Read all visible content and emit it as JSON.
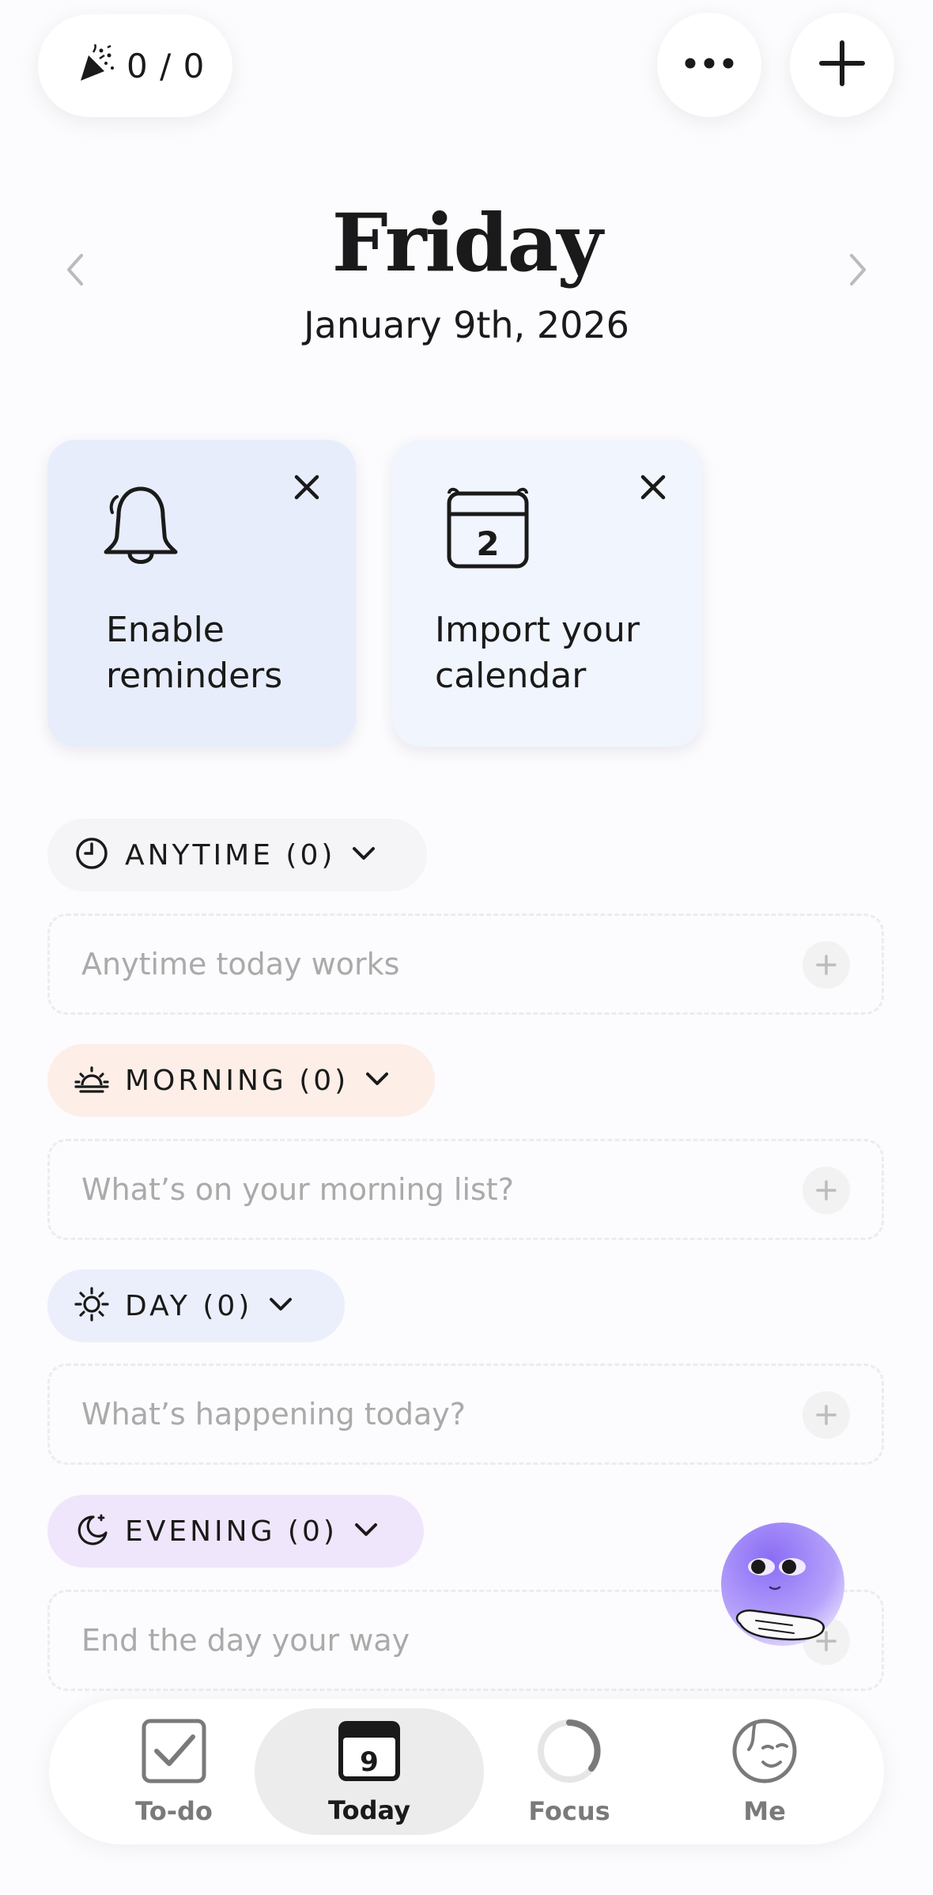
{
  "header": {
    "streak_count": "0 / 0",
    "more_icon": "ellipsis-icon",
    "add_icon": "plus-icon"
  },
  "date": {
    "weekday": "Friday",
    "full_date": "January 9th, 2026"
  },
  "cards": [
    {
      "label_line1": "Enable",
      "label_line2": "reminders",
      "icon": "bell-icon"
    },
    {
      "label_line1": "Import your",
      "label_line2": "calendar",
      "icon": "calendar-icon",
      "icon_number": "2"
    }
  ],
  "sections": {
    "anytime": {
      "label": "ANYTIME (0)",
      "placeholder": "Anytime today works"
    },
    "morning": {
      "label": "MORNING (0)",
      "placeholder": "What’s on your morning list?"
    },
    "day": {
      "label": "DAY (0)",
      "placeholder": "What’s happening today?"
    },
    "evening": {
      "label": "EVENING (0)",
      "placeholder": "End the day your way"
    }
  },
  "tabs": [
    {
      "label": "To-do",
      "icon": "checkbox-icon"
    },
    {
      "label": "Today",
      "icon": "calendar-icon",
      "icon_number": "9",
      "active": true
    },
    {
      "label": "Focus",
      "icon": "focus-ring-icon"
    },
    {
      "label": "Me",
      "icon": "face-icon"
    }
  ],
  "colors": {
    "accent_anytime": "#f5f4f6",
    "accent_morning": "#fdeee8",
    "accent_day": "#ebeffb",
    "accent_evening": "#f0e6fb",
    "mascot": "#a78bfa"
  }
}
